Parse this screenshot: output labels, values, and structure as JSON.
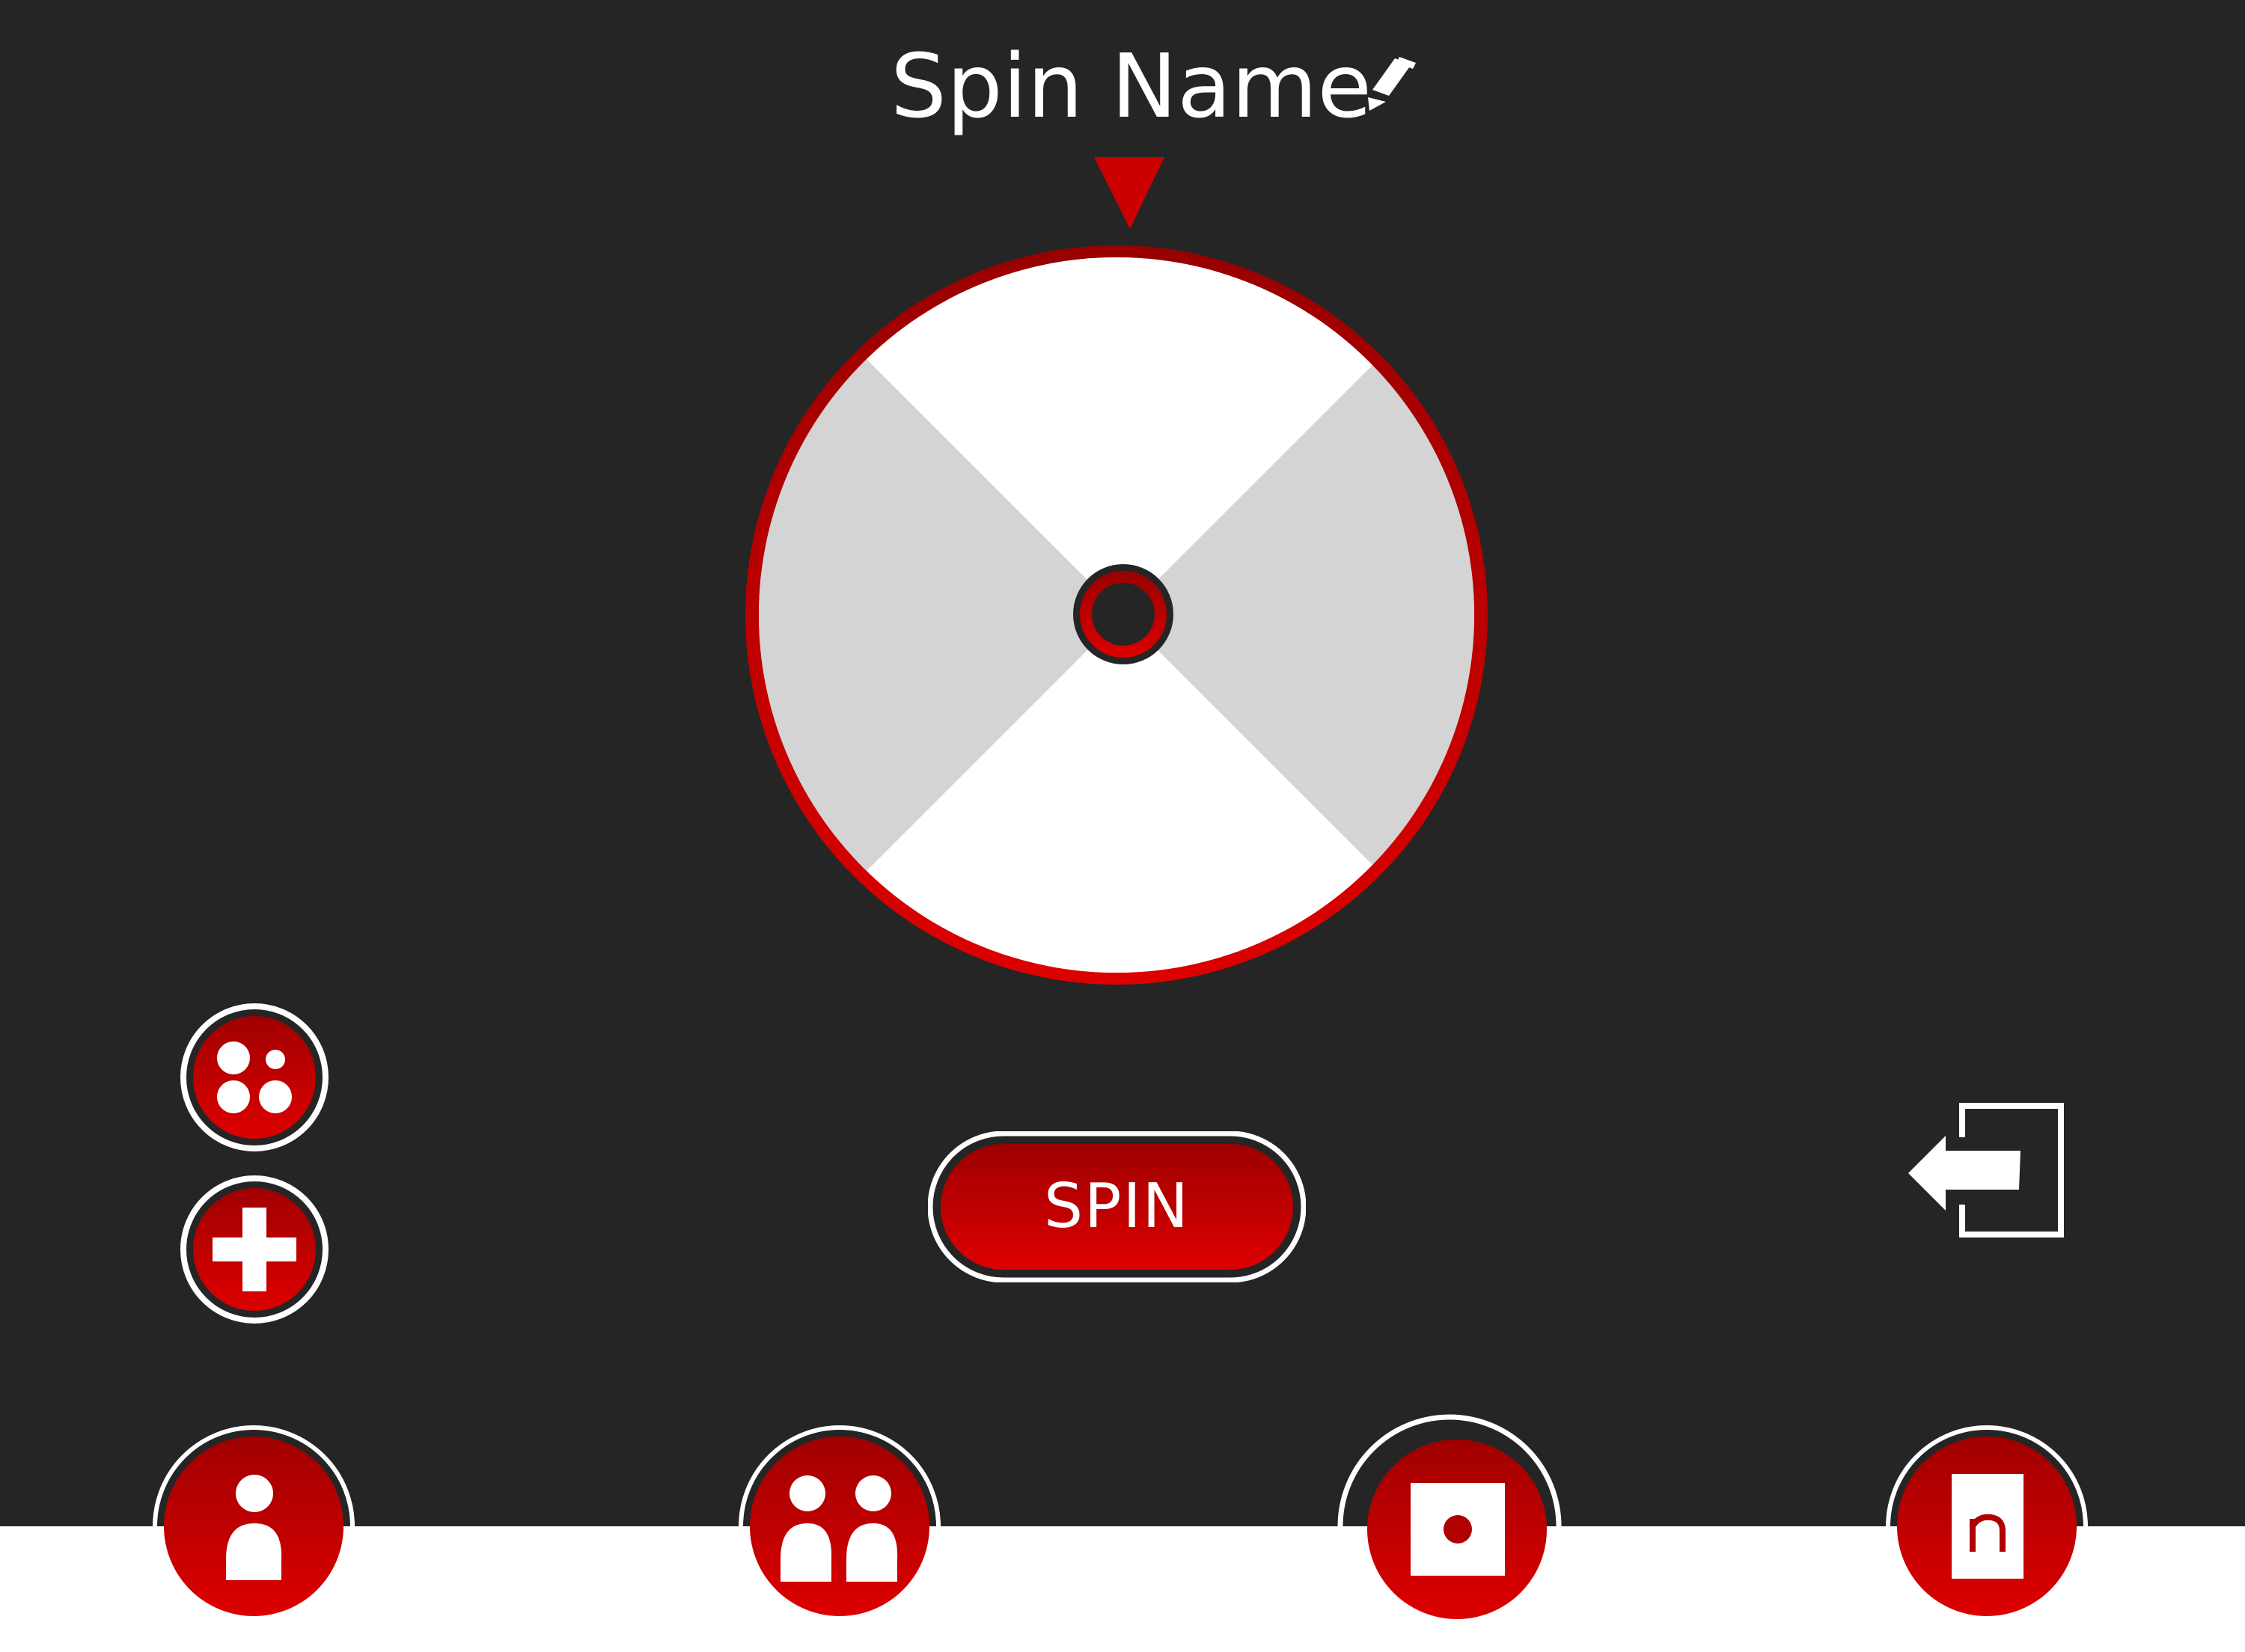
{
  "header": {
    "title": "Spin Name",
    "edit_icon": "pencil-icon"
  },
  "wheel": {
    "segments": [
      {
        "position": "top",
        "color": "#ffffff"
      },
      {
        "position": "right",
        "color": "#d4d4d4"
      },
      {
        "position": "bottom",
        "color": "#ffffff"
      },
      {
        "position": "left",
        "color": "#d4d4d4"
      }
    ],
    "rim_color": "#cc0000",
    "pointer_icon": "triangle-down-icon"
  },
  "spin_button": {
    "label": "SPIN"
  },
  "side_tools": [
    {
      "icon": "dots-icon"
    },
    {
      "icon": "plus-icon"
    }
  ],
  "back_icon": "arrow-left-into-box-icon",
  "bottom_nav": [
    {
      "icon": "single-person-icon"
    },
    {
      "icon": "two-people-icon"
    },
    {
      "icon": "die-one-icon"
    },
    {
      "icon": "n-card-icon"
    }
  ],
  "colors": {
    "background_dark": "#252525",
    "accent_red": "#cc0000",
    "accent_red_dark": "#990000",
    "white": "#ffffff"
  }
}
